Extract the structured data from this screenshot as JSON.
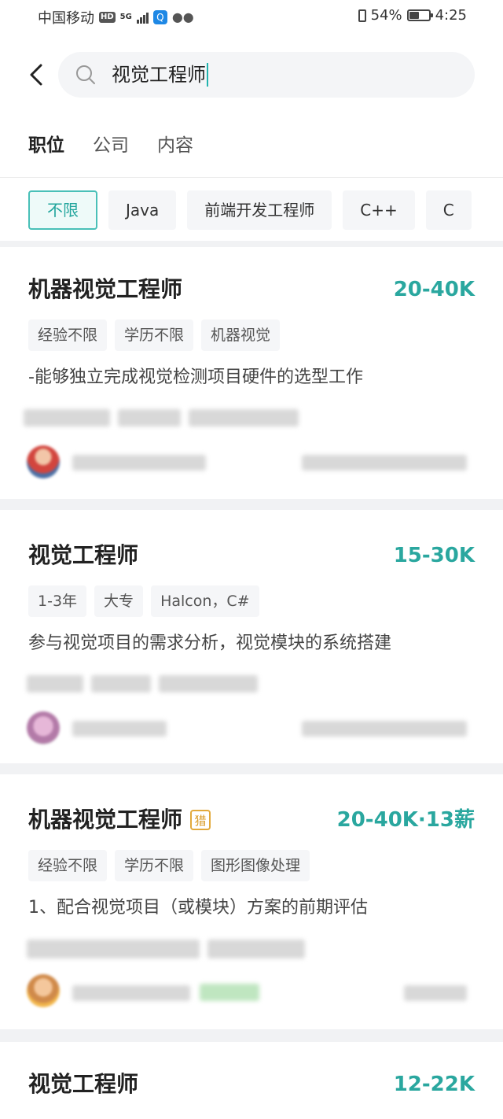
{
  "status_bar": {
    "carrier": "中国移动",
    "hd": "HD",
    "network": "5G",
    "battery_percent": "54%",
    "battery_level": 0.54,
    "time": "4:25",
    "icons": [
      "signal-icon",
      "app-icon",
      "wechat-icon",
      "vibrate-icon",
      "battery-icon"
    ]
  },
  "search": {
    "query": "视觉工程师"
  },
  "tabs": [
    {
      "label": "职位",
      "active": true
    },
    {
      "label": "公司",
      "active": false
    },
    {
      "label": "内容",
      "active": false
    }
  ],
  "filters": [
    "不限",
    "Java",
    "前端开发工程师",
    "C++",
    "C"
  ],
  "colors": {
    "accent": "#2aa79f",
    "chip_active_border": "#49c0b8",
    "hunter_badge": "#e2a93b"
  },
  "jobs": [
    {
      "title": "机器视觉工程师",
      "salary": "20-40K",
      "tags": [
        "经验不限",
        "学历不限",
        "机器视觉"
      ],
      "description": "-能够独立完成视觉检测项目硬件的选型工作",
      "hunter": false
    },
    {
      "title": "视觉工程师",
      "salary": "15-30K",
      "tags": [
        "1-3年",
        "大专",
        "Halcon，C#"
      ],
      "description": "参与视觉项目的需求分析，视觉模块的系统搭建",
      "hunter": false
    },
    {
      "title": "机器视觉工程师",
      "salary": "20-40K·13薪",
      "tags": [
        "经验不限",
        "学历不限",
        "图形图像处理"
      ],
      "description": "1、配合视觉项目（或模块）方案的前期评估",
      "hunter": true,
      "hunter_label": "猎"
    },
    {
      "title": "视觉工程师",
      "salary": "12-22K",
      "tags": [],
      "description": "",
      "hunter": false
    }
  ]
}
